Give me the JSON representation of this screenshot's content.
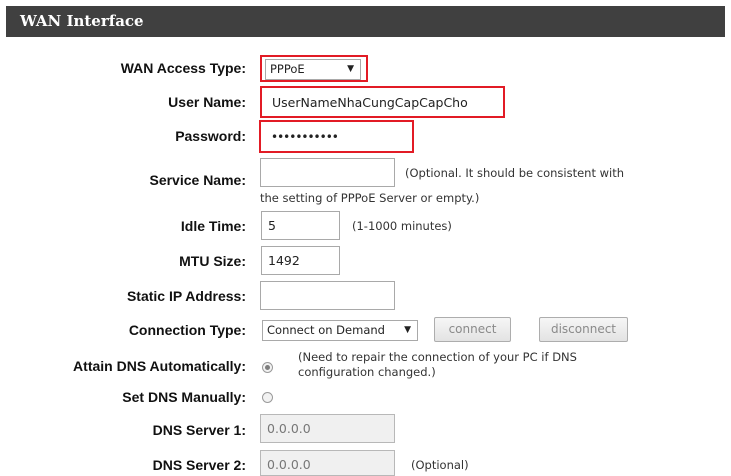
{
  "header": {
    "title": "WAN Interface"
  },
  "form": {
    "wan_access_type": {
      "label": "WAN Access Type:",
      "value": "PPPoE",
      "arrow": "▼"
    },
    "user_name": {
      "label": "User Name:",
      "value": "UserNameNhaCungCapCapCho"
    },
    "password": {
      "label": "Password:",
      "value": "•••••••••••"
    },
    "service_name": {
      "label": "Service Name:",
      "value": "",
      "note_line1": "(Optional. It should be consistent with",
      "note_line2": "the setting of PPPoE Server or empty.)"
    },
    "idle_time": {
      "label": "Idle Time:",
      "value": "5",
      "note": "(1-1000 minutes)"
    },
    "mtu_size": {
      "label": "MTU Size:",
      "value": "1492"
    },
    "static_ip": {
      "label": "Static IP Address:",
      "value": ""
    },
    "connection_type": {
      "label": "Connection Type:",
      "value": "Connect on Demand",
      "arrow": "▼",
      "connect_label": "connect",
      "disconnect_label": "disconnect"
    },
    "attain_dns": {
      "label": "Attain DNS Automatically:",
      "checked": true,
      "note_line1": "(Need to repair the connection of your PC if DNS",
      "note_line2": "configuration changed.)"
    },
    "set_dns": {
      "label": "Set DNS Manually:",
      "checked": false
    },
    "dns_server_1": {
      "label": "DNS Server 1:",
      "value": "0.0.0.0"
    },
    "dns_server_2": {
      "label": "DNS Server 2:",
      "value": "0.0.0.0",
      "note": "(Optional)"
    }
  },
  "colors": {
    "header_bg": "#404040",
    "highlight_border": "#e21b25"
  }
}
